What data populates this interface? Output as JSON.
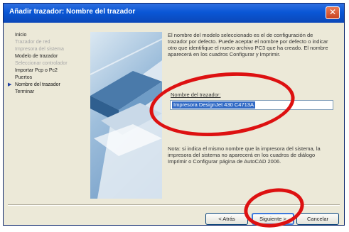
{
  "window": {
    "title": "Añadir trazador: Nombre del trazador",
    "close_icon": "close-icon",
    "close_glyph": "✕"
  },
  "steps": [
    {
      "label": "Inicio",
      "state": "normal"
    },
    {
      "label": "Trazador de red",
      "state": "disabled"
    },
    {
      "label": "Impresora del sistema",
      "state": "disabled"
    },
    {
      "label": "Modelo de trazador",
      "state": "normal"
    },
    {
      "label": "Seleccionar controlador",
      "state": "disabled"
    },
    {
      "label": "Importar Pcp o Pc2",
      "state": "normal"
    },
    {
      "label": "Puertos",
      "state": "normal"
    },
    {
      "label": "Nombre del trazador",
      "state": "current"
    },
    {
      "label": "Terminar",
      "state": "normal"
    }
  ],
  "steps_arrow": "▶",
  "content": {
    "description": "El nombre del modelo seleccionado es el de configuración de trazador por defecto. Puede aceptar el nombre por defecto o indicar otro que identifique el nuevo archivo PC3 que ha creado. El nombre aparecerá en los cuadros Configurar y Imprimir.",
    "name_label": "Nombre del trazador:",
    "name_value": "Impresora DesignJet 430 C4713A",
    "note": "Nota: si indica el mismo nombre que la impresora del sistema, la impresora del sistema no aparecerá en los cuadros de diálogo Imprimir o Configurar página de AutoCAD 2006."
  },
  "buttons": {
    "back": "< Atrás",
    "next": "Siguiente >",
    "cancel": "Cancelar"
  },
  "colors": {
    "title_bar": "#0a57d6",
    "highlight": "#316ac5",
    "annotation_circle": "#dd1111"
  }
}
